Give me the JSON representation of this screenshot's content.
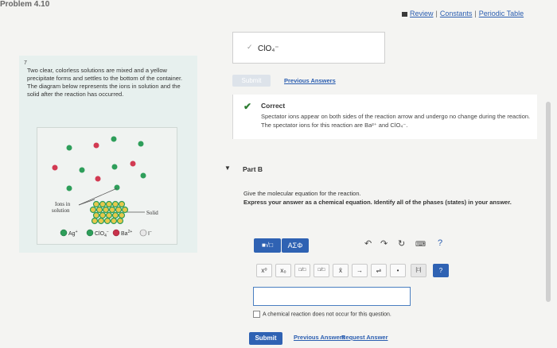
{
  "header": {
    "problem_title": "Problem 4.10",
    "links": {
      "review": "Review",
      "constants": "Constants",
      "periodic_table": "Periodic Table"
    }
  },
  "problem": {
    "marker": "7",
    "text": "Two clear, colorless solutions are mixed and a yellow precipitate forms and settles to the bottom of the container. The diagram below represents the ions in solution and the solid after the reaction has occurred.",
    "diagram": {
      "label_ions": "Ions in",
      "label_solution": "solution",
      "label_solid": "Solid",
      "legend": [
        {
          "symbol": "Ag",
          "charge": "+",
          "color": "#2e9e5a"
        },
        {
          "symbol": "ClO",
          "subscript": "4",
          "charge": "−",
          "color": "#2e9e5a"
        },
        {
          "symbol": "Ba",
          "charge": "2+",
          "color": "#c8324b"
        },
        {
          "symbol": "I",
          "charge": "−",
          "color": "#e8e8e8"
        }
      ],
      "colors": {
        "green": "#2e9e5a",
        "red": "#d23a52",
        "yellow": "#e7c84b"
      }
    }
  },
  "part_a": {
    "answer_value": "ClO₄⁻",
    "submit_label": "Submit",
    "previous_answers_label": "Previous Answers",
    "feedback": {
      "title": "Correct",
      "message": "Spectator ions appear on both sides of the reaction arrow and undergo no change during the reaction. The spectator ions for this reaction are Ba²⁺ and ClO₄⁻."
    }
  },
  "part_b": {
    "title": "Part B",
    "instruction_1": "Give the molecular equation for the reaction.",
    "instruction_2": "Express your answer as a chemical equation. Identify all of the phases (states) in your answer.",
    "toolbar": {
      "greek_label": "ΑΣΦ",
      "buttons": [
        "x⁰",
        "x₀",
        "□/□",
        "□/□",
        "x̄",
        "→",
        "⇌",
        "•",
        "[□]",
        "?"
      ]
    },
    "input_value": "",
    "no_reaction_label": "A chemical reaction does not occur for this question.",
    "submit_label": "Submit",
    "previous_answers_label": "Previous Answers",
    "request_answer_label": "Request Answer"
  },
  "accent_colors": {
    "primary": "#2f62b3",
    "correct": "#2e7d32"
  }
}
